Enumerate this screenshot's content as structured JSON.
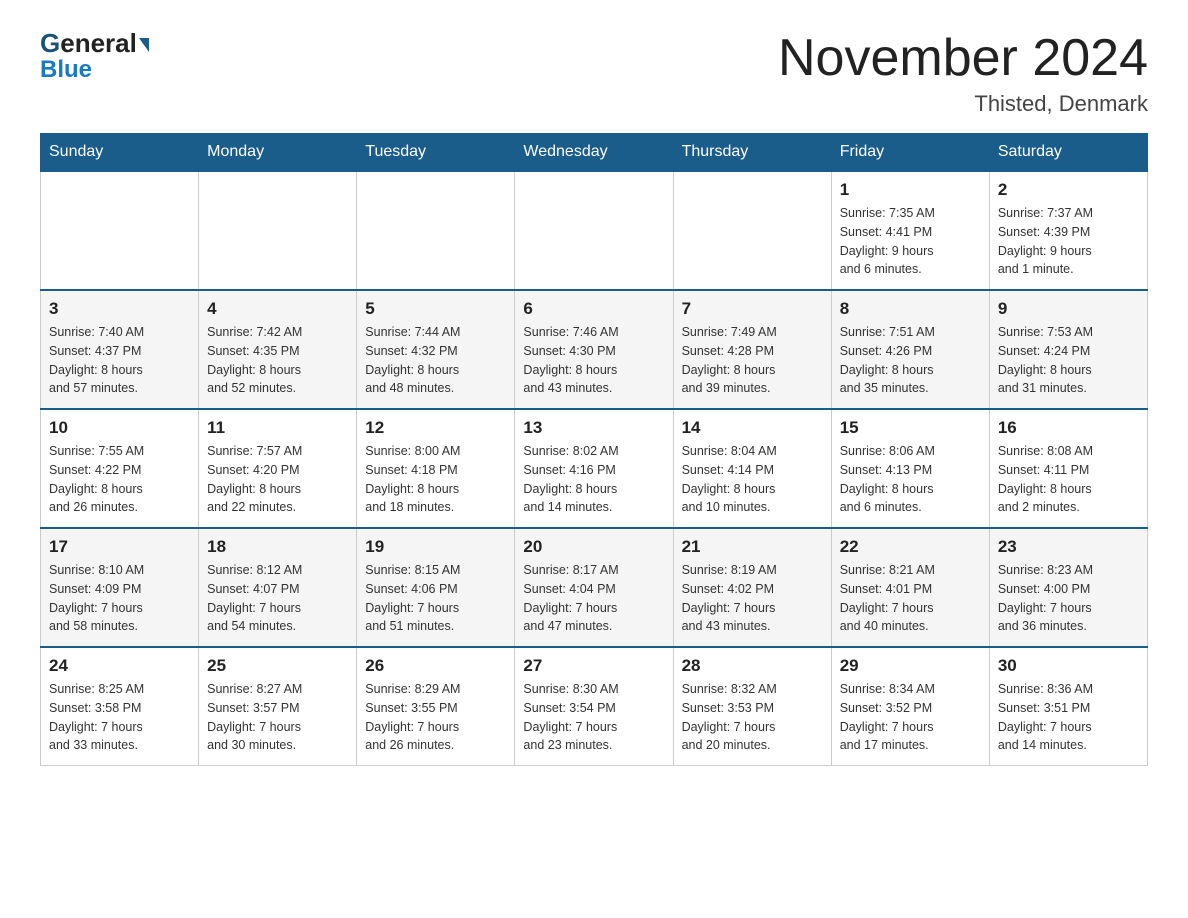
{
  "logo": {
    "general": "General",
    "blue": "Blue"
  },
  "title": {
    "month_year": "November 2024",
    "location": "Thisted, Denmark"
  },
  "days_of_week": [
    "Sunday",
    "Monday",
    "Tuesday",
    "Wednesday",
    "Thursday",
    "Friday",
    "Saturday"
  ],
  "weeks": [
    [
      {
        "day": "",
        "info": ""
      },
      {
        "day": "",
        "info": ""
      },
      {
        "day": "",
        "info": ""
      },
      {
        "day": "",
        "info": ""
      },
      {
        "day": "",
        "info": ""
      },
      {
        "day": "1",
        "info": "Sunrise: 7:35 AM\nSunset: 4:41 PM\nDaylight: 9 hours\nand 6 minutes."
      },
      {
        "day": "2",
        "info": "Sunrise: 7:37 AM\nSunset: 4:39 PM\nDaylight: 9 hours\nand 1 minute."
      }
    ],
    [
      {
        "day": "3",
        "info": "Sunrise: 7:40 AM\nSunset: 4:37 PM\nDaylight: 8 hours\nand 57 minutes."
      },
      {
        "day": "4",
        "info": "Sunrise: 7:42 AM\nSunset: 4:35 PM\nDaylight: 8 hours\nand 52 minutes."
      },
      {
        "day": "5",
        "info": "Sunrise: 7:44 AM\nSunset: 4:32 PM\nDaylight: 8 hours\nand 48 minutes."
      },
      {
        "day": "6",
        "info": "Sunrise: 7:46 AM\nSunset: 4:30 PM\nDaylight: 8 hours\nand 43 minutes."
      },
      {
        "day": "7",
        "info": "Sunrise: 7:49 AM\nSunset: 4:28 PM\nDaylight: 8 hours\nand 39 minutes."
      },
      {
        "day": "8",
        "info": "Sunrise: 7:51 AM\nSunset: 4:26 PM\nDaylight: 8 hours\nand 35 minutes."
      },
      {
        "day": "9",
        "info": "Sunrise: 7:53 AM\nSunset: 4:24 PM\nDaylight: 8 hours\nand 31 minutes."
      }
    ],
    [
      {
        "day": "10",
        "info": "Sunrise: 7:55 AM\nSunset: 4:22 PM\nDaylight: 8 hours\nand 26 minutes."
      },
      {
        "day": "11",
        "info": "Sunrise: 7:57 AM\nSunset: 4:20 PM\nDaylight: 8 hours\nand 22 minutes."
      },
      {
        "day": "12",
        "info": "Sunrise: 8:00 AM\nSunset: 4:18 PM\nDaylight: 8 hours\nand 18 minutes."
      },
      {
        "day": "13",
        "info": "Sunrise: 8:02 AM\nSunset: 4:16 PM\nDaylight: 8 hours\nand 14 minutes."
      },
      {
        "day": "14",
        "info": "Sunrise: 8:04 AM\nSunset: 4:14 PM\nDaylight: 8 hours\nand 10 minutes."
      },
      {
        "day": "15",
        "info": "Sunrise: 8:06 AM\nSunset: 4:13 PM\nDaylight: 8 hours\nand 6 minutes."
      },
      {
        "day": "16",
        "info": "Sunrise: 8:08 AM\nSunset: 4:11 PM\nDaylight: 8 hours\nand 2 minutes."
      }
    ],
    [
      {
        "day": "17",
        "info": "Sunrise: 8:10 AM\nSunset: 4:09 PM\nDaylight: 7 hours\nand 58 minutes."
      },
      {
        "day": "18",
        "info": "Sunrise: 8:12 AM\nSunset: 4:07 PM\nDaylight: 7 hours\nand 54 minutes."
      },
      {
        "day": "19",
        "info": "Sunrise: 8:15 AM\nSunset: 4:06 PM\nDaylight: 7 hours\nand 51 minutes."
      },
      {
        "day": "20",
        "info": "Sunrise: 8:17 AM\nSunset: 4:04 PM\nDaylight: 7 hours\nand 47 minutes."
      },
      {
        "day": "21",
        "info": "Sunrise: 8:19 AM\nSunset: 4:02 PM\nDaylight: 7 hours\nand 43 minutes."
      },
      {
        "day": "22",
        "info": "Sunrise: 8:21 AM\nSunset: 4:01 PM\nDaylight: 7 hours\nand 40 minutes."
      },
      {
        "day": "23",
        "info": "Sunrise: 8:23 AM\nSunset: 4:00 PM\nDaylight: 7 hours\nand 36 minutes."
      }
    ],
    [
      {
        "day": "24",
        "info": "Sunrise: 8:25 AM\nSunset: 3:58 PM\nDaylight: 7 hours\nand 33 minutes."
      },
      {
        "day": "25",
        "info": "Sunrise: 8:27 AM\nSunset: 3:57 PM\nDaylight: 7 hours\nand 30 minutes."
      },
      {
        "day": "26",
        "info": "Sunrise: 8:29 AM\nSunset: 3:55 PM\nDaylight: 7 hours\nand 26 minutes."
      },
      {
        "day": "27",
        "info": "Sunrise: 8:30 AM\nSunset: 3:54 PM\nDaylight: 7 hours\nand 23 minutes."
      },
      {
        "day": "28",
        "info": "Sunrise: 8:32 AM\nSunset: 3:53 PM\nDaylight: 7 hours\nand 20 minutes."
      },
      {
        "day": "29",
        "info": "Sunrise: 8:34 AM\nSunset: 3:52 PM\nDaylight: 7 hours\nand 17 minutes."
      },
      {
        "day": "30",
        "info": "Sunrise: 8:36 AM\nSunset: 3:51 PM\nDaylight: 7 hours\nand 14 minutes."
      }
    ]
  ]
}
